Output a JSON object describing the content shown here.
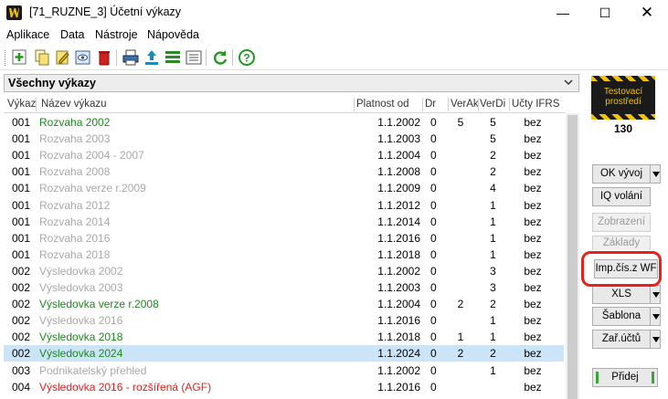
{
  "window": {
    "title": "[71_RUZNE_3] Účetní výkazy",
    "controls": {
      "minimize": "—",
      "maximize": "☐",
      "close": "✕"
    }
  },
  "menu": [
    "Aplikace",
    "Data",
    "Nástroje",
    "Nápověda"
  ],
  "toolbar_icons": [
    "add-icon",
    "copy-icon",
    "edit-icon",
    "view-icon",
    "delete-icon",
    "print-icon",
    "export-icon",
    "list-icon",
    "properties-icon",
    "refresh-icon",
    "help-icon"
  ],
  "panel": {
    "title": "Všechny výkazy"
  },
  "columns": [
    "Výkaz",
    "Název výkazu",
    "Platnost od",
    "Dr",
    "VerAk",
    "VerDi",
    "Účty IFRS"
  ],
  "rows": [
    {
      "code": "001",
      "name": "Rozvaha 2002",
      "date": "1.1.2002",
      "dr": "0",
      "verak": "5",
      "verdi": "5",
      "ifrs": "bez",
      "style": "green"
    },
    {
      "code": "001",
      "name": "Rozvaha 2003",
      "date": "1.1.2003",
      "dr": "0",
      "verak": "",
      "verdi": "5",
      "ifrs": "bez",
      "style": "gray"
    },
    {
      "code": "001",
      "name": "Rozvaha 2004 - 2007",
      "date": "1.1.2004",
      "dr": "0",
      "verak": "",
      "verdi": "2",
      "ifrs": "bez",
      "style": "gray"
    },
    {
      "code": "001",
      "name": "Rozvaha 2008",
      "date": "1.1.2008",
      "dr": "0",
      "verak": "",
      "verdi": "2",
      "ifrs": "bez",
      "style": "gray"
    },
    {
      "code": "001",
      "name": "Rozvaha verze r.2009",
      "date": "1.1.2009",
      "dr": "0",
      "verak": "",
      "verdi": "4",
      "ifrs": "bez",
      "style": "gray"
    },
    {
      "code": "001",
      "name": "Rozvaha 2012",
      "date": "1.1.2012",
      "dr": "0",
      "verak": "",
      "verdi": "1",
      "ifrs": "bez",
      "style": "gray"
    },
    {
      "code": "001",
      "name": "Rozvaha 2014",
      "date": "1.1.2014",
      "dr": "0",
      "verak": "",
      "verdi": "1",
      "ifrs": "bez",
      "style": "gray"
    },
    {
      "code": "001",
      "name": "Rozvaha 2016",
      "date": "1.1.2016",
      "dr": "0",
      "verak": "",
      "verdi": "1",
      "ifrs": "bez",
      "style": "gray"
    },
    {
      "code": "001",
      "name": "Rozvaha 2018",
      "date": "1.1.2018",
      "dr": "0",
      "verak": "",
      "verdi": "1",
      "ifrs": "bez",
      "style": "gray"
    },
    {
      "code": "002",
      "name": "Výsledovka 2002",
      "date": "1.1.2002",
      "dr": "0",
      "verak": "",
      "verdi": "3",
      "ifrs": "bez",
      "style": "gray"
    },
    {
      "code": "002",
      "name": "Výsledovka 2003",
      "date": "1.1.2003",
      "dr": "0",
      "verak": "",
      "verdi": "3",
      "ifrs": "bez",
      "style": "gray"
    },
    {
      "code": "002",
      "name": "Výsledovka verze r.2008",
      "date": "1.1.2004",
      "dr": "0",
      "verak": "2",
      "verdi": "2",
      "ifrs": "bez",
      "style": "green"
    },
    {
      "code": "002",
      "name": "Výsledovka 2016",
      "date": "1.1.2016",
      "dr": "0",
      "verak": "",
      "verdi": "1",
      "ifrs": "bez",
      "style": "gray"
    },
    {
      "code": "002",
      "name": "Výsledovka 2018",
      "date": "1.1.2018",
      "dr": "0",
      "verak": "1",
      "verdi": "1",
      "ifrs": "bez",
      "style": "green"
    },
    {
      "code": "002",
      "name": "Výsledovka 2024",
      "date": "1.1.2024",
      "dr": "0",
      "verak": "2",
      "verdi": "2",
      "ifrs": "bez",
      "style": "green",
      "selected": true
    },
    {
      "code": "003",
      "name": "Podnikatelský přehled",
      "date": "1.1.2002",
      "dr": "0",
      "verak": "",
      "verdi": "1",
      "ifrs": "bez",
      "style": "gray"
    },
    {
      "code": "004",
      "name": "Výsledovka 2016 - rozšířená (AGF)",
      "date": "1.1.2016",
      "dr": "0",
      "verak": "",
      "verdi": "",
      "ifrs": "bez",
      "style": "red"
    }
  ],
  "sidebar": {
    "env_badge": "Testovací prostředí",
    "count": "130",
    "buttons": {
      "ok_vyvoj": "OK vývoj",
      "iq_volani": "IQ volání",
      "zobrazeni": "Zobrazení",
      "zaklady": "Základy",
      "imp_cis": "Imp.čís.z WF",
      "xls": "XLS",
      "sablona": "Šablona",
      "zar_uctu": "Zař.účtů",
      "pridej": "Přidej"
    }
  }
}
